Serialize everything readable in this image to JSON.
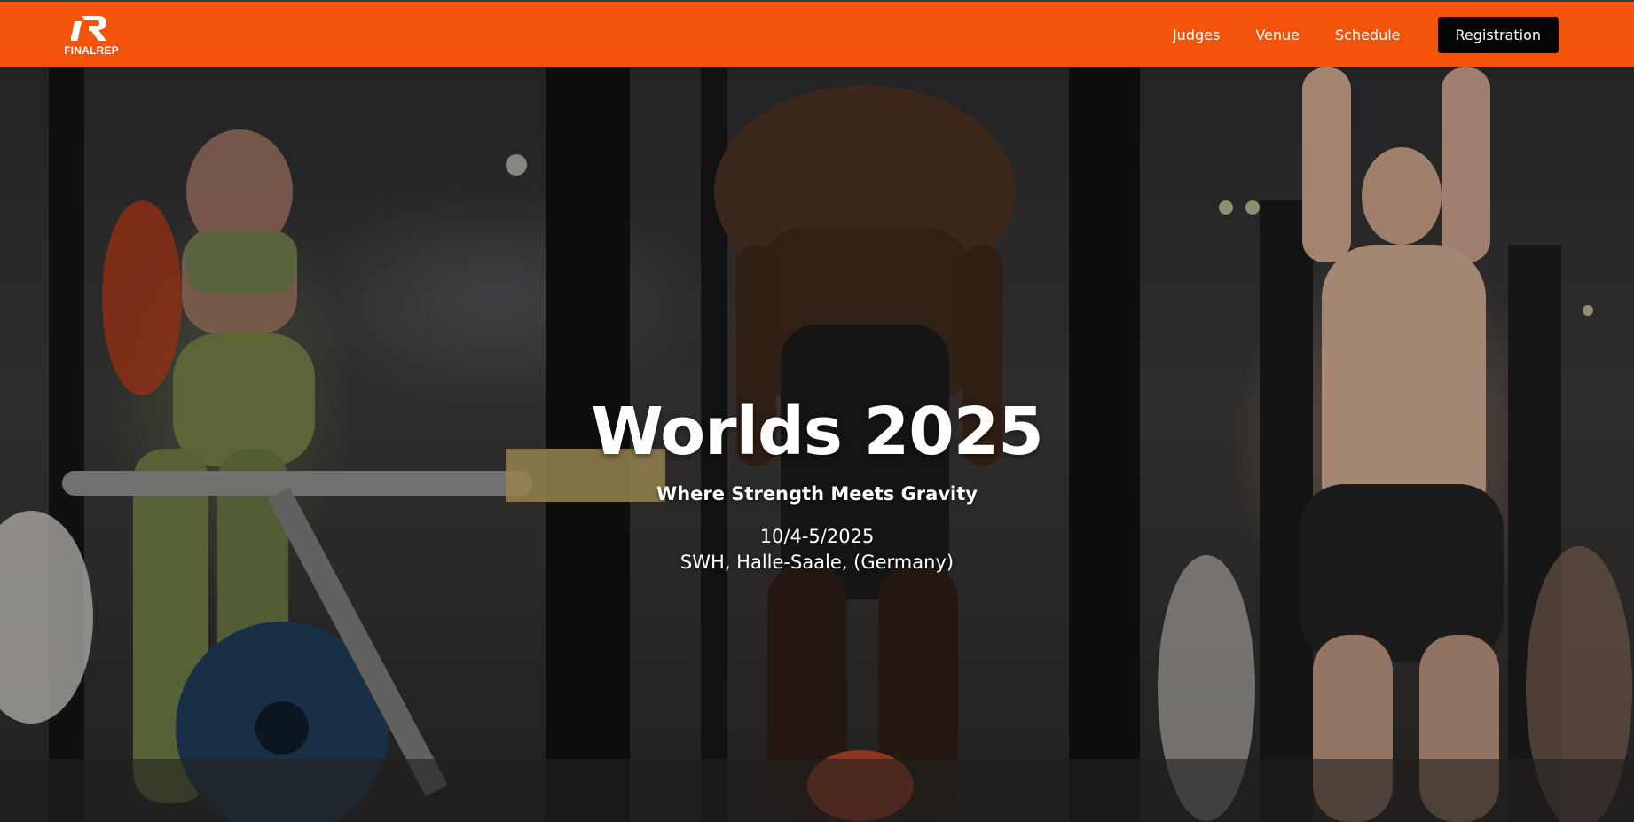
{
  "brand": {
    "name": "FINALREP",
    "accent_color": "#f2540c"
  },
  "nav": {
    "links": [
      {
        "label": "Judges"
      },
      {
        "label": "Venue"
      },
      {
        "label": "Schedule"
      }
    ],
    "cta_label": "Registration"
  },
  "hero": {
    "title": "Worlds 2025",
    "tagline": "Where Strength Meets Gravity",
    "date": "10/4-5/2025",
    "venue": "SWH, Halle-Saale, (Germany)",
    "background": "photo of athletes performing weighted dips and pull-ups"
  },
  "icons": {
    "logo": "finalrep-r-logo"
  }
}
